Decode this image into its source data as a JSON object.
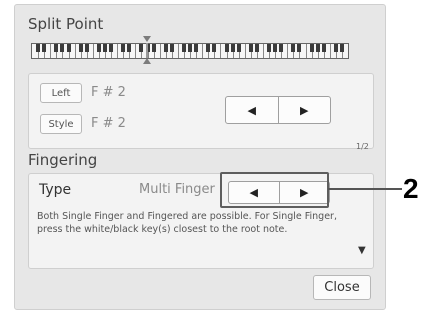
{
  "split_point": {
    "title": "Split Point",
    "left_label": "Left",
    "left_value": "F # 2",
    "style_label": "Style",
    "style_value": "F # 2",
    "prev_icon": "◀",
    "next_icon": "▶"
  },
  "page_indicator": "1/2",
  "fingering": {
    "title": "Fingering",
    "type_label": "Type",
    "type_value": "Multi Finger",
    "prev_icon": "◀",
    "next_icon": "▶",
    "description": "Both Single Finger and Fingered are possible. For Single Finger, press the white/black key(s) closest to the root note."
  },
  "scroll_down_icon": "▼",
  "close_label": "Close",
  "callout": "2"
}
